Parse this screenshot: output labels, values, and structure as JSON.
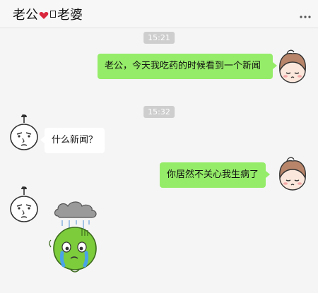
{
  "header": {
    "name_left": "老公",
    "name_right": "老婆",
    "heart_icon": "heart-icon",
    "more_icon": "more-dots-icon"
  },
  "messages": [
    {
      "type": "time",
      "text": "15:21"
    },
    {
      "type": "msg",
      "from": "me",
      "text": "  老公，今天我吃药的时候看到一个新闻"
    },
    {
      "type": "time",
      "text": "15:32"
    },
    {
      "type": "msg",
      "from": "other",
      "text": "什么新闻？"
    },
    {
      "type": "msg",
      "from": "me",
      "text": "你居然不关心我生病了"
    },
    {
      "type": "sticker",
      "from": "other",
      "icon": "crying-frog-sticker"
    }
  ],
  "colors": {
    "my_bubble": "#95ec69",
    "other_bubble": "#ffffff",
    "background": "#f5f5f5",
    "time_label": "#cecece"
  }
}
